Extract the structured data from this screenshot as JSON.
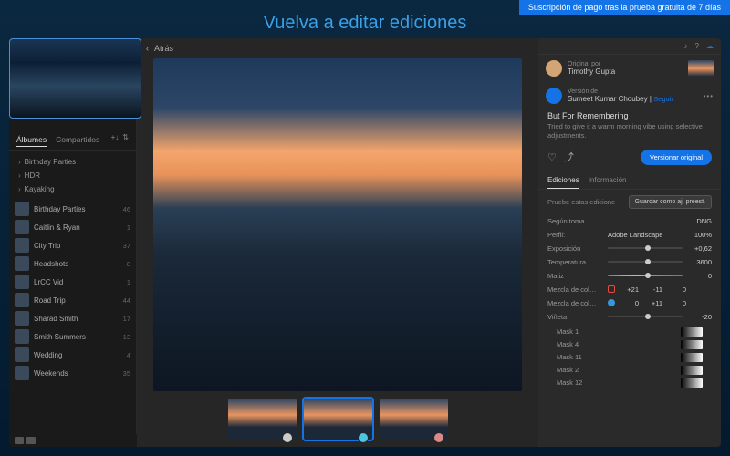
{
  "banner": "Suscripción de pago tras la prueba gratuita de 7 días",
  "headline": "Vuelva a editar ediciones",
  "sidebar": {
    "tabs": [
      "Álbumes",
      "Compartidos"
    ],
    "folders": [
      "Birthday Parties",
      "HDR",
      "Kayaking"
    ],
    "albums": [
      {
        "name": "Birthday Parties",
        "count": "46"
      },
      {
        "name": "Caitlin & Ryan",
        "count": "1"
      },
      {
        "name": "City Trip",
        "count": "37"
      },
      {
        "name": "Headshots",
        "count": "8"
      },
      {
        "name": "LrCC Vid",
        "count": "1"
      },
      {
        "name": "Road Trip",
        "count": "44"
      },
      {
        "name": "Sharad Smith",
        "count": "17"
      },
      {
        "name": "Smith Summers",
        "count": "13"
      },
      {
        "name": "Wedding",
        "count": "4"
      },
      {
        "name": "Weekends",
        "count": "35"
      }
    ]
  },
  "main": {
    "back": "Atrás"
  },
  "panel": {
    "original_by_label": "Original por",
    "original_author": "Timothy Gupta",
    "version_by_label": "Versión de",
    "version_author": "Sumeet Kumar Choubey",
    "follow": "Seguir",
    "title": "But For Remembering",
    "desc": "Tried to give it a warm morning vibe using selective adjustments.",
    "version_btn": "Versionar original",
    "tabs": [
      "Ediciones",
      "Información"
    ],
    "preset_label": "Pruebe estas edicione",
    "preset_btn": "Guardar como aj. preest.",
    "shot_label": "Según toma",
    "shot_val": "DNG",
    "profile_label": "Perfil:",
    "profile_val": "Adobe Landscape",
    "profile_pct": "100%",
    "sliders": [
      {
        "label": "Exposición",
        "val": "+0,62"
      },
      {
        "label": "Temperatura",
        "val": "3600"
      },
      {
        "label": "Matiz",
        "val": "0"
      }
    ],
    "mix1_label": "Mezcla de col…",
    "mix1_a": "+21",
    "mix1_b": "-11",
    "mix1_c": "0",
    "mix2_label": "Mezcla de col…",
    "mix2_a": "0",
    "mix2_b": "+11",
    "mix2_c": "0",
    "vignette_label": "Viñeta",
    "vignette_val": "-20",
    "masks": [
      "Mask 1",
      "Mask 4",
      "Mask 11",
      "Mask 2",
      "Mask 12"
    ]
  }
}
